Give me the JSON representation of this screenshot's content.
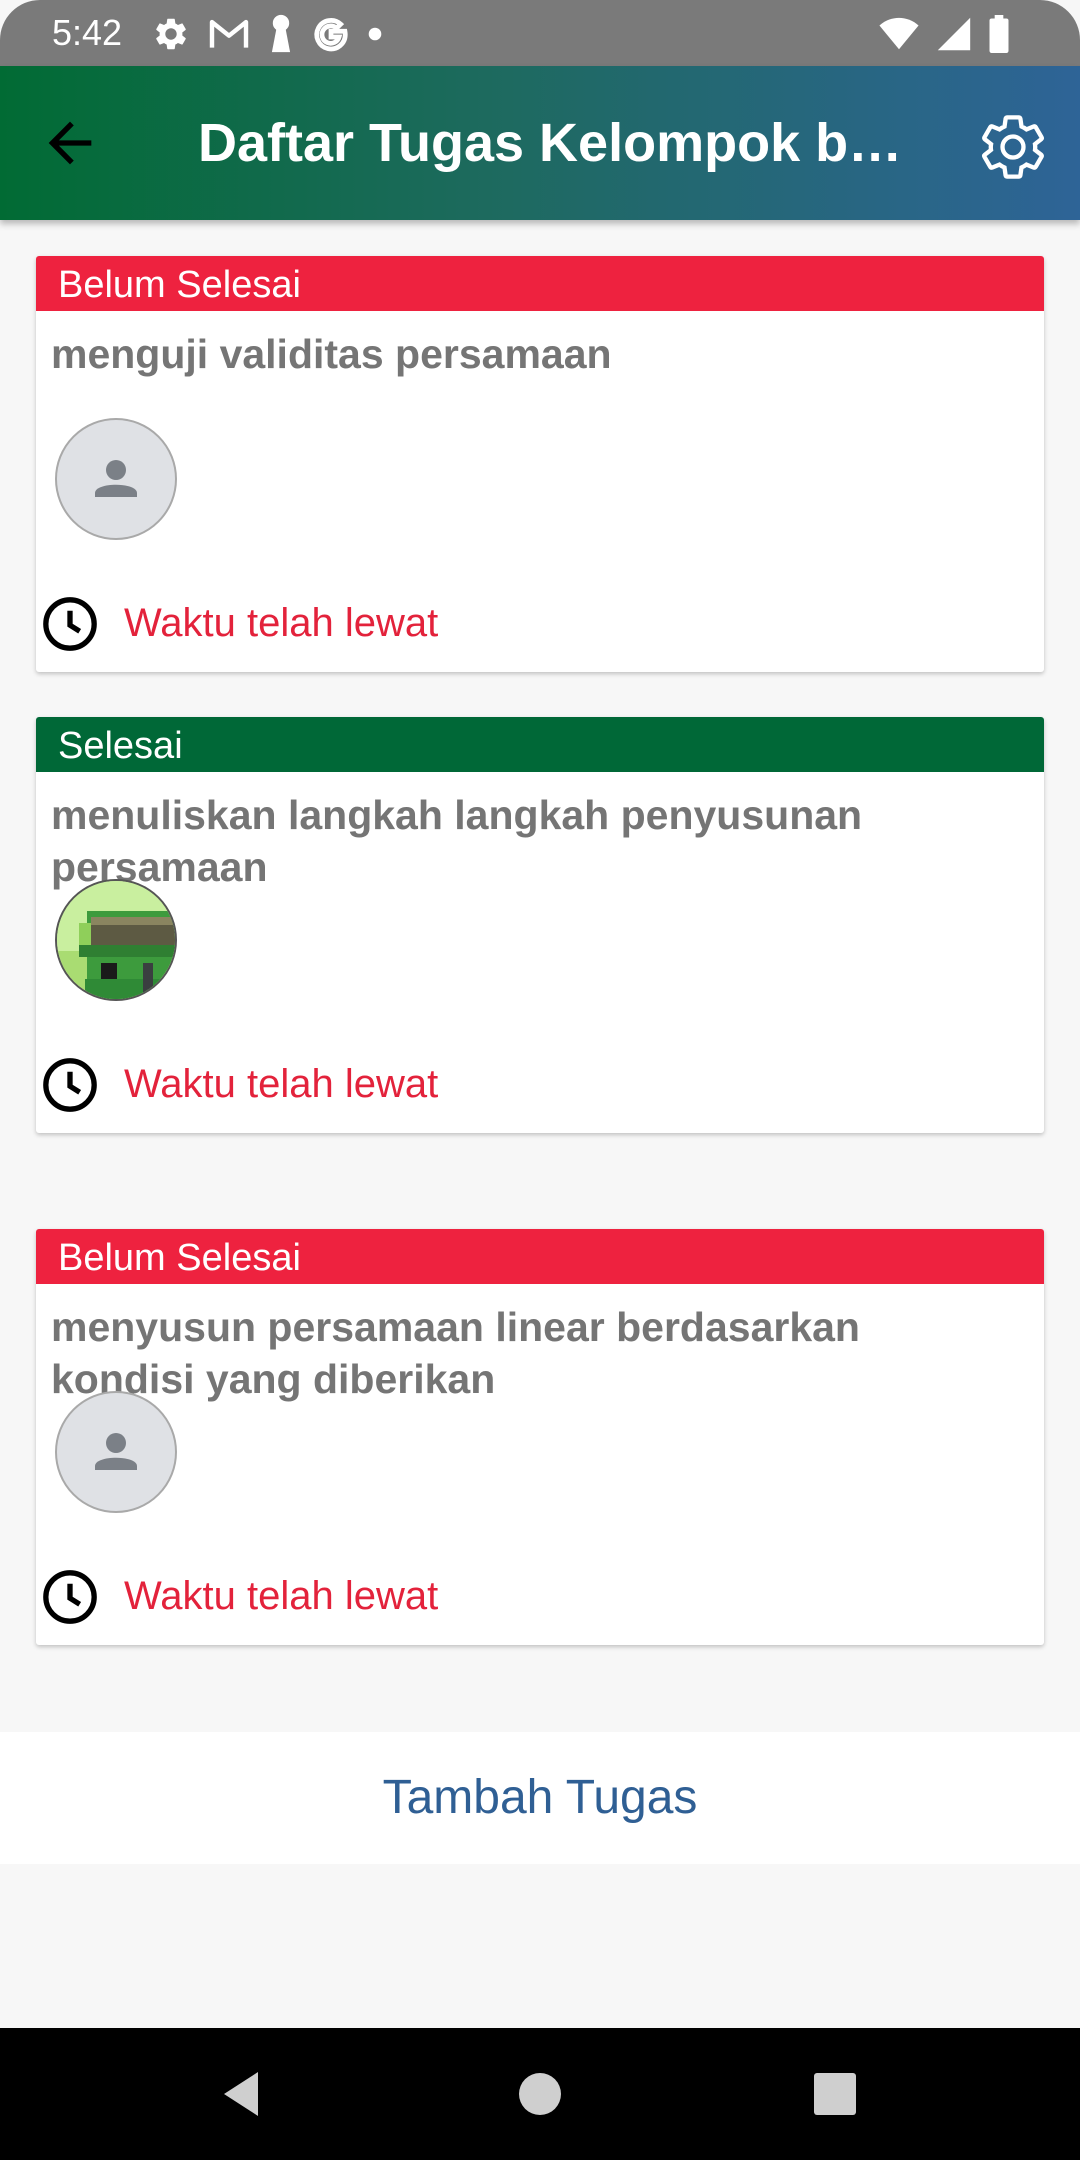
{
  "status_bar": {
    "time": "5:42"
  },
  "app_bar": {
    "title": "Daftar Tugas Kelompok bua…",
    "back_icon": "arrow-back-icon",
    "settings_icon": "gear-icon"
  },
  "tasks": [
    {
      "status": "Belum Selesai",
      "status_color": "#ee223f",
      "title": "menguji validitas persamaan",
      "avatar": "default-person-avatar",
      "deadline": "Waktu telah lewat"
    },
    {
      "status": "Selesai",
      "status_color": "#006837",
      "title": "menuliskan langkah langkah penyusunan persamaan",
      "avatar": "pixel-art-avatar",
      "deadline": "Waktu telah lewat"
    },
    {
      "status": "Belum Selesai",
      "status_color": "#ee223f",
      "title": "menyusun persamaan linear berdasarkan kondisi yang diberikan",
      "avatar": "default-person-avatar",
      "deadline": "Waktu telah lewat"
    }
  ],
  "add_task_label": "Tambah Tugas",
  "colors": {
    "app_bar_start": "#016b34",
    "app_bar_end": "#2e6497",
    "pending": "#ee223f",
    "done": "#006837",
    "deadline_text": "#e3223b",
    "add_task_text": "#2f5f94"
  }
}
